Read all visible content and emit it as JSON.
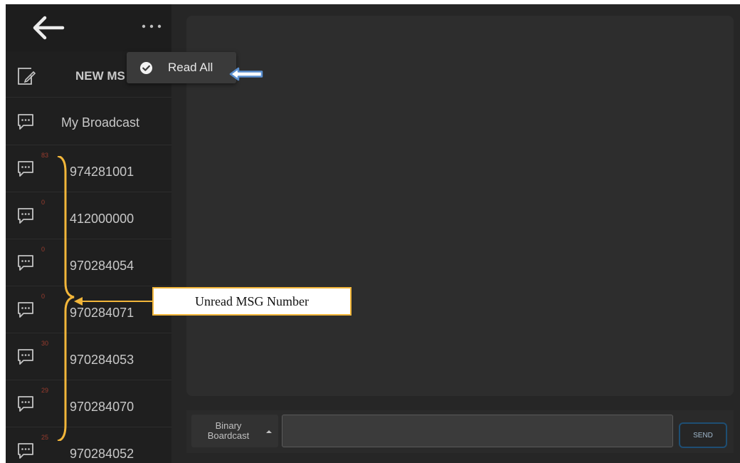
{
  "sidebar": {
    "new_msg_label": "NEW MS",
    "broadcast_label": "My Broadcast",
    "contacts": [
      {
        "number": "974281001",
        "unread": "83"
      },
      {
        "number": "412000000",
        "unread": "0"
      },
      {
        "number": "970284054",
        "unread": "0"
      },
      {
        "number": "970284071",
        "unread": "0"
      },
      {
        "number": "970284053",
        "unread": "30"
      },
      {
        "number": "970284070",
        "unread": "29"
      },
      {
        "number": "970284052",
        "unread": "25"
      }
    ]
  },
  "popup": {
    "read_all_label": "Read All"
  },
  "composer": {
    "binary_label": "Binary Boardcast",
    "send_label": "SEND",
    "message_value": ""
  },
  "annotation": {
    "label": "Unread MSG Number"
  },
  "icons": {
    "back": "arrow-left-icon",
    "more": "more-dots-icon",
    "compose": "compose-icon",
    "chat": "chat-bubble-icon",
    "check": "check-circle-icon"
  },
  "colors": {
    "background": "#262626",
    "sidebar": "#1f1f1f",
    "badge": "#9a3c2e",
    "annotation_border": "#f2b63a",
    "send_border": "#1e4e73"
  }
}
